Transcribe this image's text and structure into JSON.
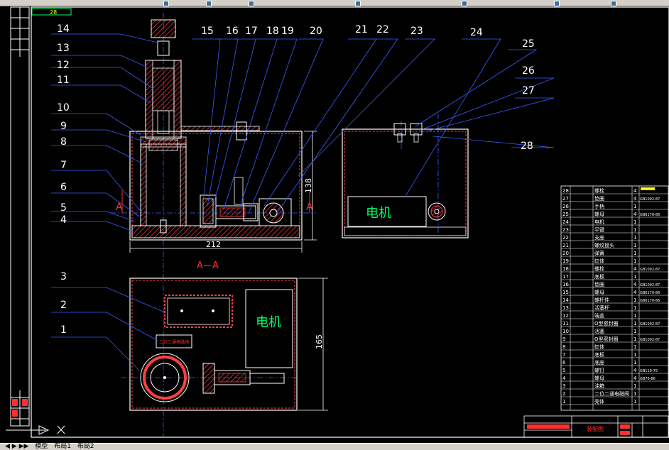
{
  "colors": {
    "background": "#000000",
    "outline": "#ffffff",
    "hatch": "#ff4040",
    "leader": "#3a5cff",
    "text": "#ffffff",
    "label_green": "#00ff66",
    "yellow": "#ffff00",
    "toolbar": "#d4d0c8"
  },
  "part_numbers": [
    "1",
    "2",
    "3",
    "4",
    "5",
    "6",
    "7",
    "8",
    "9",
    "10",
    "11",
    "12",
    "13",
    "14",
    "15",
    "16",
    "17",
    "18",
    "19",
    "20",
    "21",
    "22",
    "23",
    "24",
    "25",
    "26",
    "27",
    "28"
  ],
  "dimensions": {
    "width_front": "212",
    "height_front": "138",
    "depth_top": "165"
  },
  "section": {
    "marker": "A",
    "title": "A—A"
  },
  "motor_label": "电机",
  "label_box_text": "二位二通电磁阀",
  "top_border_text": "28",
  "title_block_text": "装配图",
  "bom": [
    {
      "no": "28",
      "name": "螺栓",
      "qty": "4",
      "std": ""
    },
    {
      "no": "27",
      "name": "垫圈",
      "qty": "4",
      "std": "GB1092-87"
    },
    {
      "no": "26",
      "name": "手柄",
      "qty": "1",
      "std": ""
    },
    {
      "no": "25",
      "name": "螺母",
      "qty": "4",
      "std": "GB6170-86"
    },
    {
      "no": "24",
      "name": "电机",
      "qty": "1",
      "std": ""
    },
    {
      "no": "23",
      "name": "平键",
      "qty": "1",
      "std": ""
    },
    {
      "no": "22",
      "name": "支座",
      "qty": "1",
      "std": ""
    },
    {
      "no": "21",
      "name": "螺纹接头",
      "qty": "1",
      "std": ""
    },
    {
      "no": "20",
      "name": "弹簧",
      "qty": "1",
      "std": ""
    },
    {
      "no": "19",
      "name": "缸体",
      "qty": "1",
      "std": ""
    },
    {
      "no": "18",
      "name": "螺栓",
      "qty": "4",
      "std": "GB1092-87"
    },
    {
      "no": "17",
      "name": "底板",
      "qty": "1",
      "std": ""
    },
    {
      "no": "16",
      "name": "垫圈",
      "qty": "4",
      "std": "GB1092-87"
    },
    {
      "no": "15",
      "name": "螺母",
      "qty": "4",
      "std": "GB6170-86"
    },
    {
      "no": "14",
      "name": "螺杆件",
      "qty": "1",
      "std": "GB6170-86"
    },
    {
      "no": "13",
      "name": "活塞杆",
      "qty": "1",
      "std": ""
    },
    {
      "no": "12",
      "name": "端盖",
      "qty": "1",
      "std": ""
    },
    {
      "no": "11",
      "name": "O型密封圈",
      "qty": "1",
      "std": "GB1092-87"
    },
    {
      "no": "10",
      "name": "活塞",
      "qty": "1",
      "std": ""
    },
    {
      "no": "9",
      "name": "O型密封圈",
      "qty": "1",
      "std": "GB1092-87"
    },
    {
      "no": "8",
      "name": "缸体",
      "qty": "1",
      "std": ""
    },
    {
      "no": "7",
      "name": "底板",
      "qty": "1",
      "std": ""
    },
    {
      "no": "6",
      "name": "底座",
      "qty": "1",
      "std": ""
    },
    {
      "no": "5",
      "name": "螺钉",
      "qty": "4",
      "std": "GB119-76"
    },
    {
      "no": "4",
      "name": "螺母",
      "qty": "4",
      "std": "GB76-86"
    },
    {
      "no": "3",
      "name": "油箱",
      "qty": "1",
      "std": ""
    },
    {
      "no": "2",
      "name": "二位二通电磁阀",
      "qty": "1",
      "std": ""
    },
    {
      "no": "1",
      "name": "壳体",
      "qty": "1",
      "std": ""
    }
  ],
  "tabs": [
    "模型",
    "布局1",
    "布局2"
  ]
}
